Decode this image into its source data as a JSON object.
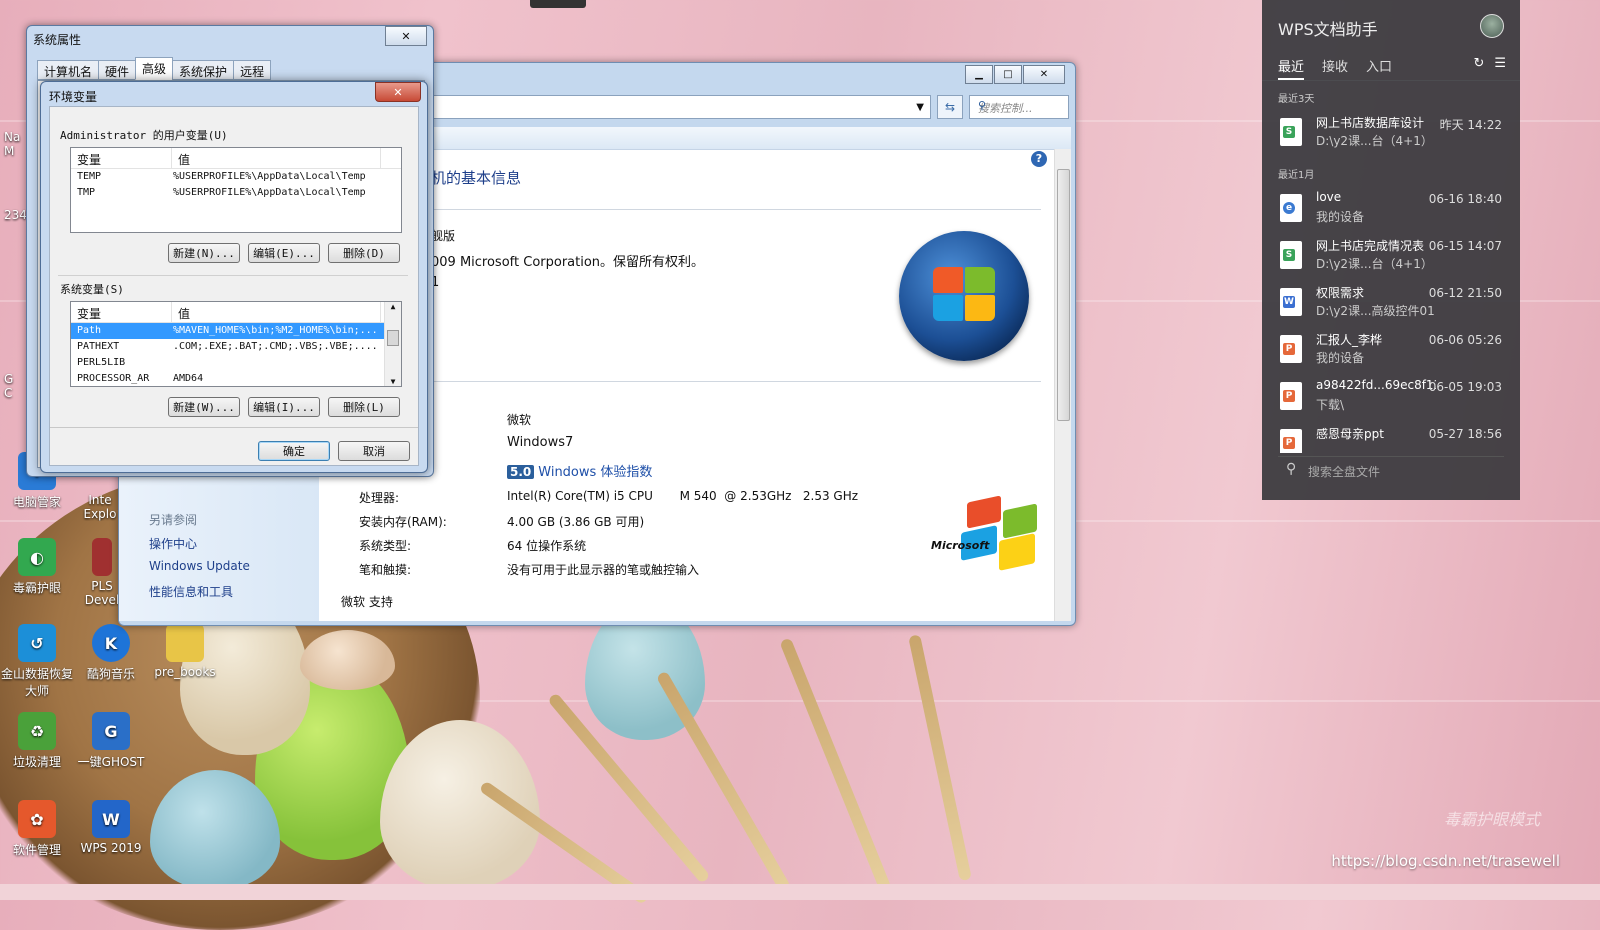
{
  "desktop": {
    "icons": [
      {
        "label": "电脑管家",
        "color": "#2a7bd6"
      },
      {
        "label": "Inte Explo",
        "color": "#1f6fc5"
      },
      {
        "label": "毒霸护眼",
        "color": "#32a84f"
      },
      {
        "label": "PLS Devel",
        "color": "#a03030"
      },
      {
        "label": "金山数据恢复大师",
        "color": "#1c8fd8"
      },
      {
        "label": "酷狗音乐",
        "color": "#1e74d8"
      },
      {
        "label": "pre_books",
        "color": "#e8c547"
      },
      {
        "label": "垃圾清理",
        "color": "#4aa13a"
      },
      {
        "label": "一键GHOST",
        "color": "#2a6fc8"
      },
      {
        "label": "软件管理",
        "color": "#e5582c"
      },
      {
        "label": "WPS 2019",
        "color": "#2366c9"
      }
    ],
    "left_fragments": [
      "Na",
      "M",
      "234",
      "G",
      "C"
    ],
    "watermark": "毒霸护眼模式",
    "url": "https://blog.csdn.net/trasewell"
  },
  "control_panel": {
    "search_placeholder": "搜索控制...",
    "help": "?",
    "heading": "机的基本信息",
    "edition_line": "舰版",
    "copyright": "009 Microsoft Corporation。保留所有权利。",
    "sp_fragment": "1",
    "nav": {
      "see_also": "另请参阅",
      "links": [
        "操作中心",
        "Windows Update",
        "性能信息和工具"
      ]
    },
    "system": {
      "rating_label": "",
      "manufacturer": "微软",
      "model": "Windows7",
      "rating_score": "5.0",
      "rating_link": "Windows 体验指数",
      "rows": [
        {
          "label": "处理器:",
          "value": "Intel(R) Core(TM) i5 CPU       M 540  @ 2.53GHz   2.53 GHz"
        },
        {
          "label": "安装内存(RAM):",
          "value": "4.00 GB (3.86 GB 可用)"
        },
        {
          "label": "系统类型:",
          "value": "64 位操作系统"
        },
        {
          "label": "笔和触摸:",
          "value": "没有可用于此显示器的笔或触控输入"
        }
      ],
      "support": "微软 支持"
    },
    "ms_logo_text": "Microsoft"
  },
  "system_properties": {
    "title": "系统属性",
    "tabs": [
      "计算机名",
      "硬件",
      "高级",
      "系统保护",
      "远程"
    ],
    "active_tab": 2
  },
  "env_vars": {
    "title": "环境变量",
    "user_legend": "Administrator 的用户变量(U)",
    "system_legend": "系统变量(S)",
    "col_var": "变量",
    "col_val": "值",
    "user_vars": [
      {
        "name": "TEMP",
        "value": "%USERPROFILE%\\AppData\\Local\\Temp"
      },
      {
        "name": "TMP",
        "value": "%USERPROFILE%\\AppData\\Local\\Temp"
      }
    ],
    "system_vars": [
      {
        "name": "Path",
        "value": "%MAVEN_HOME%\\bin;%M2_HOME%\\bin;..."
      },
      {
        "name": "PATHEXT",
        "value": ".COM;.EXE;.BAT;.CMD;.VBS;.VBE;...."
      },
      {
        "name": "PERL5LIB",
        "value": ""
      },
      {
        "name": "PROCESSOR_AR",
        "value": "AMD64"
      }
    ],
    "user_buttons": {
      "new": "新建(N)...",
      "edit": "编辑(E)...",
      "delete": "删除(D)"
    },
    "system_buttons": {
      "new": "新建(W)...",
      "edit": "编辑(I)...",
      "delete": "删除(L)"
    },
    "ok": "确定",
    "cancel": "取消"
  },
  "wps": {
    "title": "WPS文档助手",
    "tabs": [
      "最近",
      "接收",
      "入口"
    ],
    "section_recent3": "最近3天",
    "section_recent1m": "最近1月",
    "recent3": [
      {
        "name": "网上书店数据库设计",
        "path": "D:\\y2课...台（4+1）",
        "time": "昨天 14:22",
        "type": "S",
        "color": "#3aa35a"
      }
    ],
    "recent1m": [
      {
        "name": "love",
        "path": "我的设备",
        "time": "06-16 18:40",
        "type": "e",
        "color": "#3b7ad1"
      },
      {
        "name": "网上书店完成情况表",
        "path": "D:\\y2课...台（4+1）",
        "time": "06-15 14:07",
        "type": "S",
        "color": "#3aa35a"
      },
      {
        "name": "权限需求",
        "path": "D:\\y2课...高级控件01",
        "time": "06-12 21:50",
        "type": "W",
        "color": "#3b6fd1"
      },
      {
        "name": "汇报人_李桦",
        "path": "我的设备",
        "time": "06-06 05:26",
        "type": "P",
        "color": "#e5683a"
      },
      {
        "name": "a98422fd...69ec8f13",
        "path": "下载\\",
        "time": "06-05 19:03",
        "type": "P",
        "color": "#e5683a"
      },
      {
        "name": "感恩母亲ppt",
        "path": "",
        "time": "05-27 18:56",
        "type": "P",
        "color": "#e5683a"
      }
    ],
    "search_placeholder": "搜索全盘文件"
  }
}
